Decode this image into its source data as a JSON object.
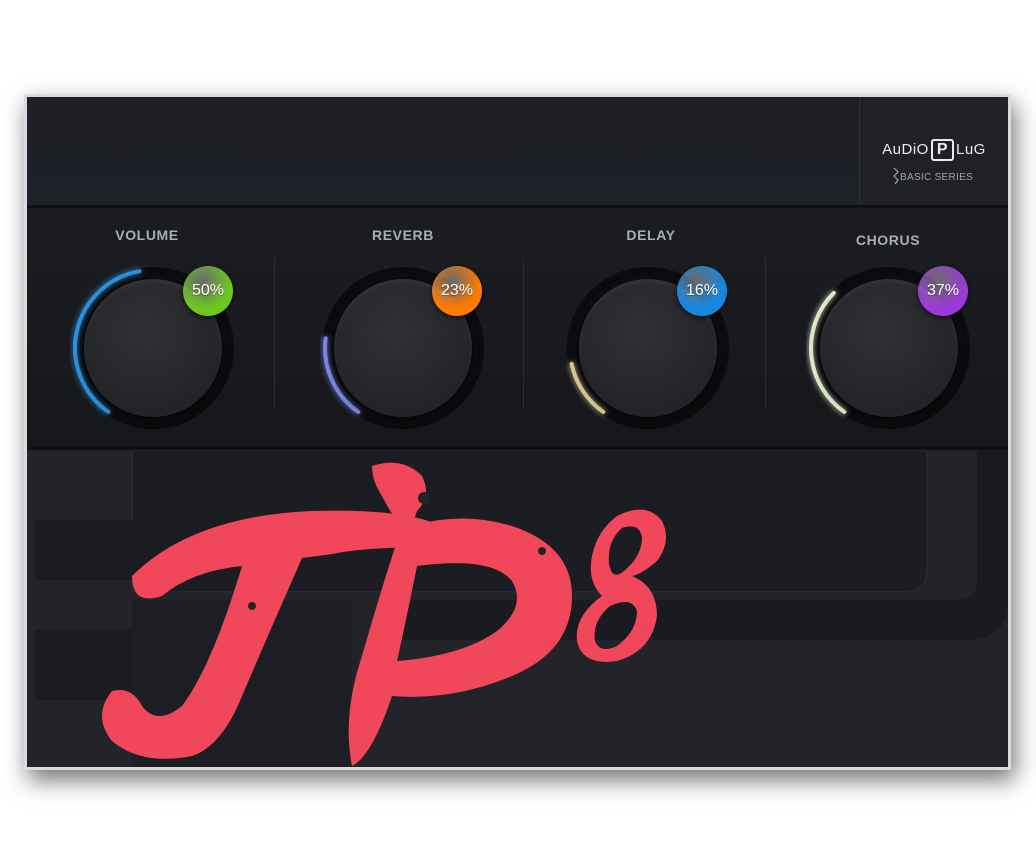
{
  "brand": {
    "logo_pre": "AuDiO",
    "logo_p": "P",
    "logo_post": "LuG",
    "series": "BASIC SERIES"
  },
  "knobs": [
    {
      "label": "VOLUME",
      "value": 50,
      "display": "50%",
      "color": "#6dc71e",
      "ring_color": "#2f8fd8"
    },
    {
      "label": "REVERB",
      "value": 23,
      "display": "23%",
      "color": "#ff7a00",
      "ring_color": "#7a86e0"
    },
    {
      "label": "DELAY",
      "value": 16,
      "display": "16%",
      "color": "#1687e0",
      "ring_color": "#d8c890"
    },
    {
      "label": "CHORUS",
      "value": 37,
      "display": "37%",
      "color": "#9b3ad8",
      "ring_color": "#dfe8c8"
    }
  ],
  "theme": {
    "logo_color": "#f0475a",
    "background": "#1e2026"
  }
}
